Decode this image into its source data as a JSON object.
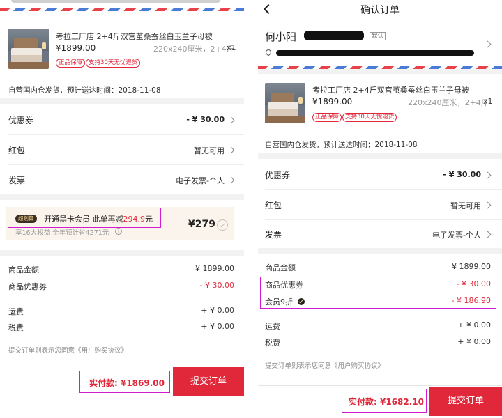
{
  "product": {
    "title": "考拉工厂店 2+4斤双宫茧桑蚕丝白玉兰子母被",
    "price": "¥1899.00",
    "spec": "220x240厘米，2+4斤",
    "qty": "x1",
    "tags": [
      "正品保障",
      "支持30天无忧退货"
    ]
  },
  "shipping": "自营国内仓发货，预计送达时间：2018-11-08",
  "rows": {
    "coupon_label": "优惠券",
    "coupon_value": "- ¥ 30.00",
    "redpacket_label": "红包",
    "redpacket_value": "暂无可用",
    "invoice_label": "发票",
    "invoice_value": "电子发票-个人"
  },
  "blackcard": {
    "badge": "超划算",
    "text": "开通黑卡会员 此单再减",
    "save": "294.9",
    "unit": "元",
    "sub": "享16大权益 全年预计省4271元",
    "price": "¥279"
  },
  "summary_left": [
    {
      "label": "商品金额",
      "value": "¥ 1899.00",
      "red": false
    },
    {
      "label": "商品优惠券",
      "value": "- ¥ 30.00",
      "red": true
    },
    {
      "label": "运费",
      "value": "+ ¥ 0.00",
      "red": false
    },
    {
      "label": "税费",
      "value": "+ ¥ 0.00",
      "red": false
    }
  ],
  "summary_right": [
    {
      "label": "商品金额",
      "value": "¥ 1899.00",
      "red": false
    },
    {
      "label": "商品优惠券",
      "value": "- ¥ 30.00",
      "red": true
    },
    {
      "label": "会员9折",
      "value": "- ¥ 186.90",
      "red": true
    },
    {
      "label": "运费",
      "value": "+ ¥ 0.00",
      "red": false
    },
    {
      "label": "税费",
      "value": "+ ¥ 0.00",
      "red": false
    }
  ],
  "agreement": "提交订单则表示您同意《用户购买协议》",
  "footer_left": {
    "total": "实付款: ¥1869.00",
    "submit": "提交订单"
  },
  "footer_right": {
    "total": "实付款: ¥1682.10",
    "submit": "提交订单"
  },
  "header": {
    "title": "确认订单",
    "back_icon": "chevron-left-icon"
  },
  "address": {
    "name": "何小阳",
    "badge": "默认",
    "location_icon": "location-pin-icon"
  },
  "colors": {
    "accent": "#e0283a",
    "highlight": "#d21cd2",
    "blackcard_bg": "#fbf4ec"
  }
}
